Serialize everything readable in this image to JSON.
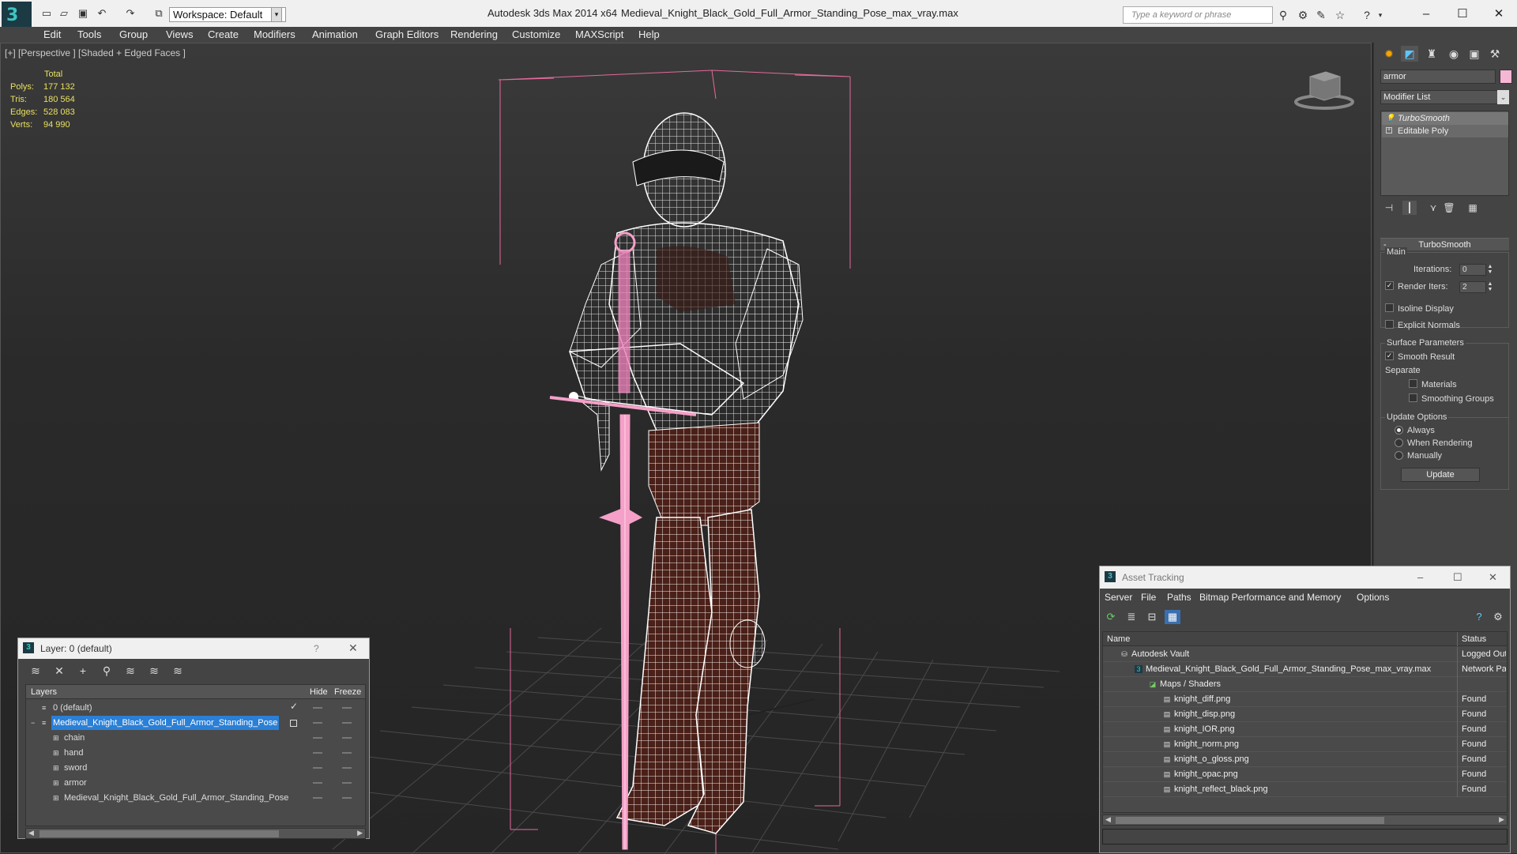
{
  "titlebar": {
    "workspace": "Workspace: Default",
    "app_title": "Autodesk 3ds Max  2014 x64",
    "file_title": "Medieval_Knight_Black_Gold_Full_Armor_Standing_Pose_max_vray.max",
    "search_placeholder": "Type a keyword or phrase"
  },
  "menu": [
    "Edit",
    "Tools",
    "Group",
    "Views",
    "Create",
    "Modifiers",
    "Animation",
    "Graph Editors",
    "Rendering",
    "Customize",
    "MAXScript",
    "Help"
  ],
  "viewport": {
    "label": "[+] [Perspective ] [Shaded + Edged Faces ]",
    "stats": {
      "header": "Total",
      "rows": [
        {
          "label": "Polys:",
          "value": "177 132"
        },
        {
          "label": "Tris:",
          "value": "180 564"
        },
        {
          "label": "Edges:",
          "value": "528 083"
        },
        {
          "label": "Verts:",
          "value": "94 990"
        }
      ]
    },
    "wire_color": "#ffffff",
    "selection_color": "#f5a0c8"
  },
  "command_panel": {
    "object_name": "armor",
    "object_color": "#f5b7d3",
    "modifier_list": "Modifier List",
    "stack": [
      "TurboSmooth",
      "Editable Poly"
    ],
    "rollout_title": "TurboSmooth",
    "main_label": "Main",
    "iterations_label": "Iterations:",
    "iterations_value": "0",
    "render_iters_label": "Render Iters:",
    "render_iters_value": "2",
    "isoline_label": "Isoline Display",
    "explicit_label": "Explicit Normals",
    "surface_label": "Surface Parameters",
    "smooth_label": "Smooth Result",
    "separate_label": "Separate",
    "materials_label": "Materials",
    "smoothing_label": "Smoothing Groups",
    "update_options_label": "Update Options",
    "always_label": "Always",
    "when_rendering_label": "When Rendering",
    "manually_label": "Manually",
    "update_button": "Update"
  },
  "layers": {
    "title": "Layer: 0 (default)",
    "help": "?",
    "col_layers": "Layers",
    "col_hide": "Hide",
    "col_freeze": "Freeze",
    "rows": [
      {
        "name": "0 (default)",
        "indent": 0
      },
      {
        "name": "Medieval_Knight_Black_Gold_Full_Armor_Standing_Pose",
        "indent": 0,
        "selected": true
      },
      {
        "name": "chain",
        "indent": 1
      },
      {
        "name": "hand",
        "indent": 1
      },
      {
        "name": "sword",
        "indent": 1
      },
      {
        "name": "armor",
        "indent": 1
      },
      {
        "name": "Medieval_Knight_Black_Gold_Full_Armor_Standing_Pose",
        "indent": 1
      }
    ]
  },
  "assets": {
    "title": "Asset Tracking",
    "menu": [
      "Server",
      "File",
      "Paths",
      "Bitmap Performance and Memory",
      "Options"
    ],
    "col_name": "Name",
    "col_status": "Status",
    "rows": [
      {
        "name": "Autodesk Vault",
        "status": "Logged Out",
        "indent": 0
      },
      {
        "name": "Medieval_Knight_Black_Gold_Full_Armor_Standing_Pose_max_vray.max",
        "status": "Network Path",
        "indent": 1
      },
      {
        "name": "Maps / Shaders",
        "status": "",
        "indent": 2
      },
      {
        "name": "knight_diff.png",
        "status": "Found",
        "indent": 3
      },
      {
        "name": "knight_disp.png",
        "status": "Found",
        "indent": 3
      },
      {
        "name": "knight_IOR.png",
        "status": "Found",
        "indent": 3
      },
      {
        "name": "knight_norm.png",
        "status": "Found",
        "indent": 3
      },
      {
        "name": "knight_o_gloss.png",
        "status": "Found",
        "indent": 3
      },
      {
        "name": "knight_opac.png",
        "status": "Found",
        "indent": 3
      },
      {
        "name": "knight_reflect_black.png",
        "status": "Found",
        "indent": 3
      }
    ]
  }
}
